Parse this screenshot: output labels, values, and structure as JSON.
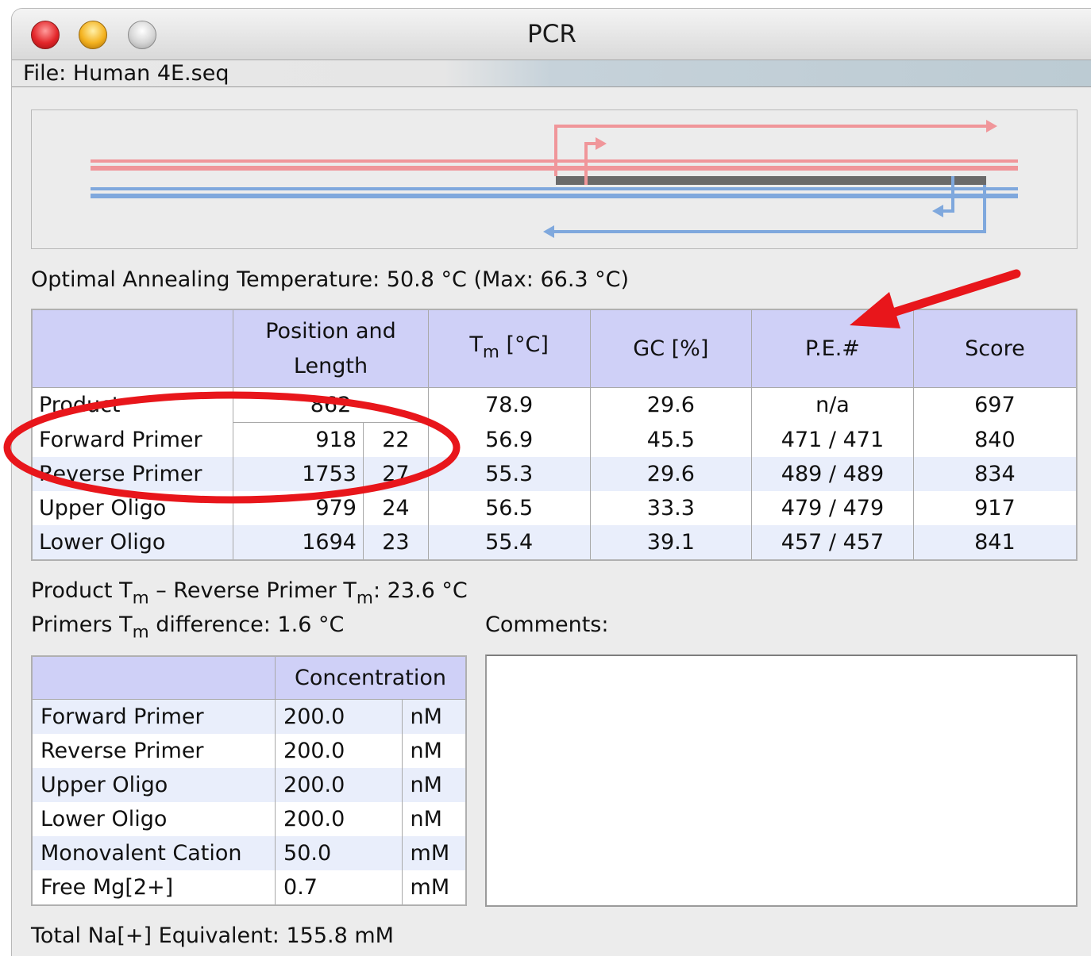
{
  "window": {
    "title": "PCR"
  },
  "file": {
    "label": "File: Human 4E.seq"
  },
  "annealing": {
    "text": "Optimal Annealing Temperature: 50.8 °C (Max: 66.3 °C)"
  },
  "main_table": {
    "headers": {
      "position_line1": "Position and",
      "position_line2": "Length",
      "tm_base": "T",
      "tm_sub": "m",
      "tm_unit": " [°C]",
      "gc": "GC [%]",
      "pe": "P.E.#",
      "score": "Score"
    },
    "rows": [
      {
        "name": "Product",
        "position": "862",
        "length": "",
        "tm": "78.9",
        "gc": "29.6",
        "pe": "n/a",
        "score": "697"
      },
      {
        "name": "Forward Primer",
        "position": "918",
        "length": "22",
        "tm": "56.9",
        "gc": "45.5",
        "pe": "471 / 471",
        "score": "840"
      },
      {
        "name": "Reverse Primer",
        "position": "1753",
        "length": "27",
        "tm": "55.3",
        "gc": "29.6",
        "pe": "489 / 489",
        "score": "834"
      },
      {
        "name": "Upper Oligo",
        "position": "979",
        "length": "24",
        "tm": "56.5",
        "gc": "33.3",
        "pe": "479 / 479",
        "score": "917"
      },
      {
        "name": "Lower Oligo",
        "position": "1694",
        "length": "23",
        "tm": "55.4",
        "gc": "39.1",
        "pe": "457 / 457",
        "score": "841"
      }
    ]
  },
  "stats": {
    "line1_a": "Product T",
    "line1_sub1": "m",
    "line1_b": " – Reverse Primer T",
    "line1_sub2": "m",
    "line1_c": ": 23.6 °C",
    "line2_a": "Primers T",
    "line2_sub": "m",
    "line2_b": " difference: 1.6 °C"
  },
  "comments": {
    "label": "Comments:",
    "value": ""
  },
  "conc_table": {
    "header": "Concentration",
    "rows": [
      {
        "name": "Forward Primer",
        "value": "200.0",
        "unit": "nM"
      },
      {
        "name": "Reverse Primer",
        "value": "200.0",
        "unit": "nM"
      },
      {
        "name": "Upper Oligo",
        "value": "200.0",
        "unit": "nM"
      },
      {
        "name": "Lower Oligo",
        "value": "200.0",
        "unit": "nM"
      },
      {
        "name": "Monovalent Cation",
        "value": "50.0",
        "unit": "mM"
      },
      {
        "name": "Free Mg[2+]",
        "value": "0.7",
        "unit": "mM"
      }
    ]
  },
  "total": {
    "text": "Total Na[+] Equivalent: 155.8 mM"
  },
  "colors": {
    "header_bg": "#cfd0f7",
    "row_alt": "#e9eefb",
    "forward_strand": "#f0969a",
    "reverse_strand": "#7fa8dd",
    "annotation": "#e8161b"
  }
}
